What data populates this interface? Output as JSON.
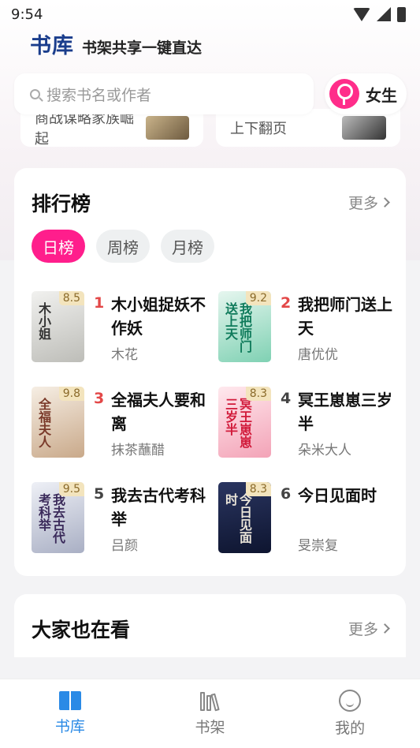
{
  "status_bar": {
    "time": "9:54"
  },
  "header": {
    "brand": "书库",
    "slogan": "书架共享一键直达"
  },
  "search": {
    "placeholder": "搜索书名或作者"
  },
  "gender_toggle": {
    "label": "女生"
  },
  "banner": {
    "left_text": "商战谋略家族崛起",
    "right_text": "上下翻页"
  },
  "ranking": {
    "title": "排行榜",
    "more": "更多",
    "tabs": [
      "日榜",
      "周榜",
      "月榜"
    ],
    "active_tab": "日榜",
    "books": [
      {
        "rank": "1",
        "title": "木小姐捉妖不作妖",
        "author": "木花",
        "score": "8.5",
        "cover_text": "木小姐"
      },
      {
        "rank": "2",
        "title": "我把师门送上天",
        "author": "唐优优",
        "score": "9.2",
        "cover_text": "我把师门送上天"
      },
      {
        "rank": "3",
        "title": "全福夫人要和离",
        "author": "抹茶蘸醋",
        "score": "9.8",
        "cover_text": "全福夫人"
      },
      {
        "rank": "4",
        "title": "冥王崽崽三岁半",
        "author": "朵米大人",
        "score": "8.3",
        "cover_text": "冥王崽崽三岁半"
      },
      {
        "rank": "5",
        "title": "我去古代考科举",
        "author": "吕颜",
        "score": "9.5",
        "cover_text": "我去古代考科举"
      },
      {
        "rank": "6",
        "title": "今日见面时",
        "author": "旻崇复",
        "score": "8.3",
        "cover_text": "今日见面时"
      }
    ]
  },
  "also_reading": {
    "title": "大家也在看",
    "more": "更多"
  },
  "bottom_nav": {
    "items": [
      {
        "label": "书库",
        "icon": "book-open-icon",
        "active": true
      },
      {
        "label": "书架",
        "icon": "bookshelf-icon",
        "active": false
      },
      {
        "label": "我的",
        "icon": "smile-icon",
        "active": false
      }
    ]
  },
  "colors": {
    "accent_pink": "#ff1e8c",
    "brand_blue": "#1a3d8c",
    "nav_active": "#2a8ae6",
    "rank_red": "#e34848"
  }
}
